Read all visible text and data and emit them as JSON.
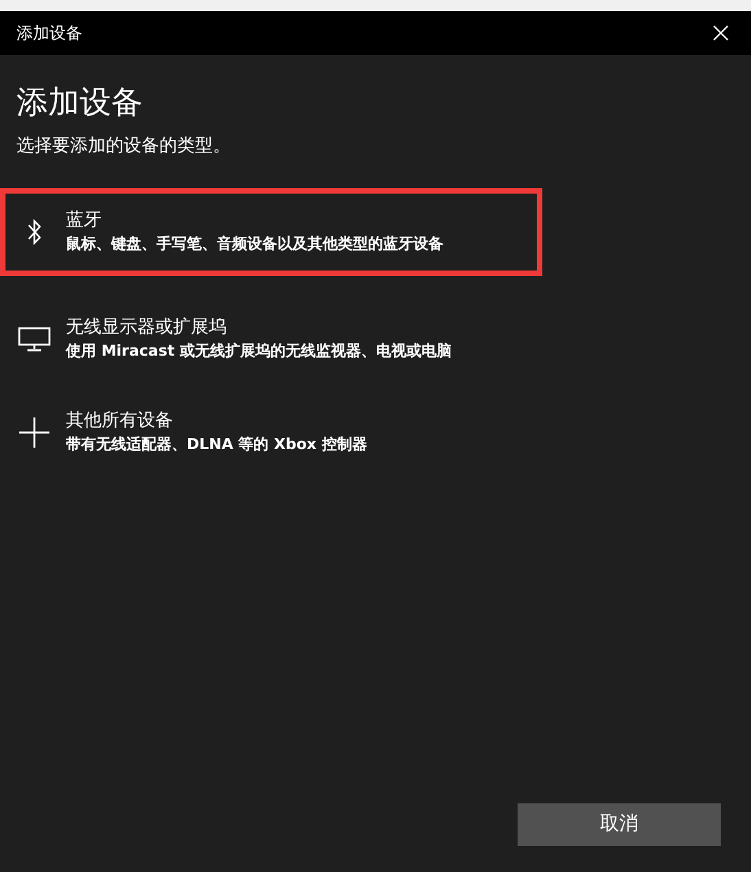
{
  "window": {
    "title": "添加设备"
  },
  "heading": "添加设备",
  "subtitle": "选择要添加的设备的类型。",
  "device_types": [
    {
      "kind": "bluetooth",
      "title": "蓝牙",
      "description": "鼠标、键盘、手写笔、音频设备以及其他类型的蓝牙设备",
      "highlighted": true
    },
    {
      "kind": "display",
      "title": "无线显示器或扩展坞",
      "description": "使用 Miracast 或无线扩展坞的无线监视器、电视或电脑",
      "highlighted": false
    },
    {
      "kind": "other",
      "title": "其他所有设备",
      "description": "带有无线适配器、DLNA 等的 Xbox 控制器",
      "highlighted": false
    }
  ],
  "buttons": [
    "取消"
  ]
}
